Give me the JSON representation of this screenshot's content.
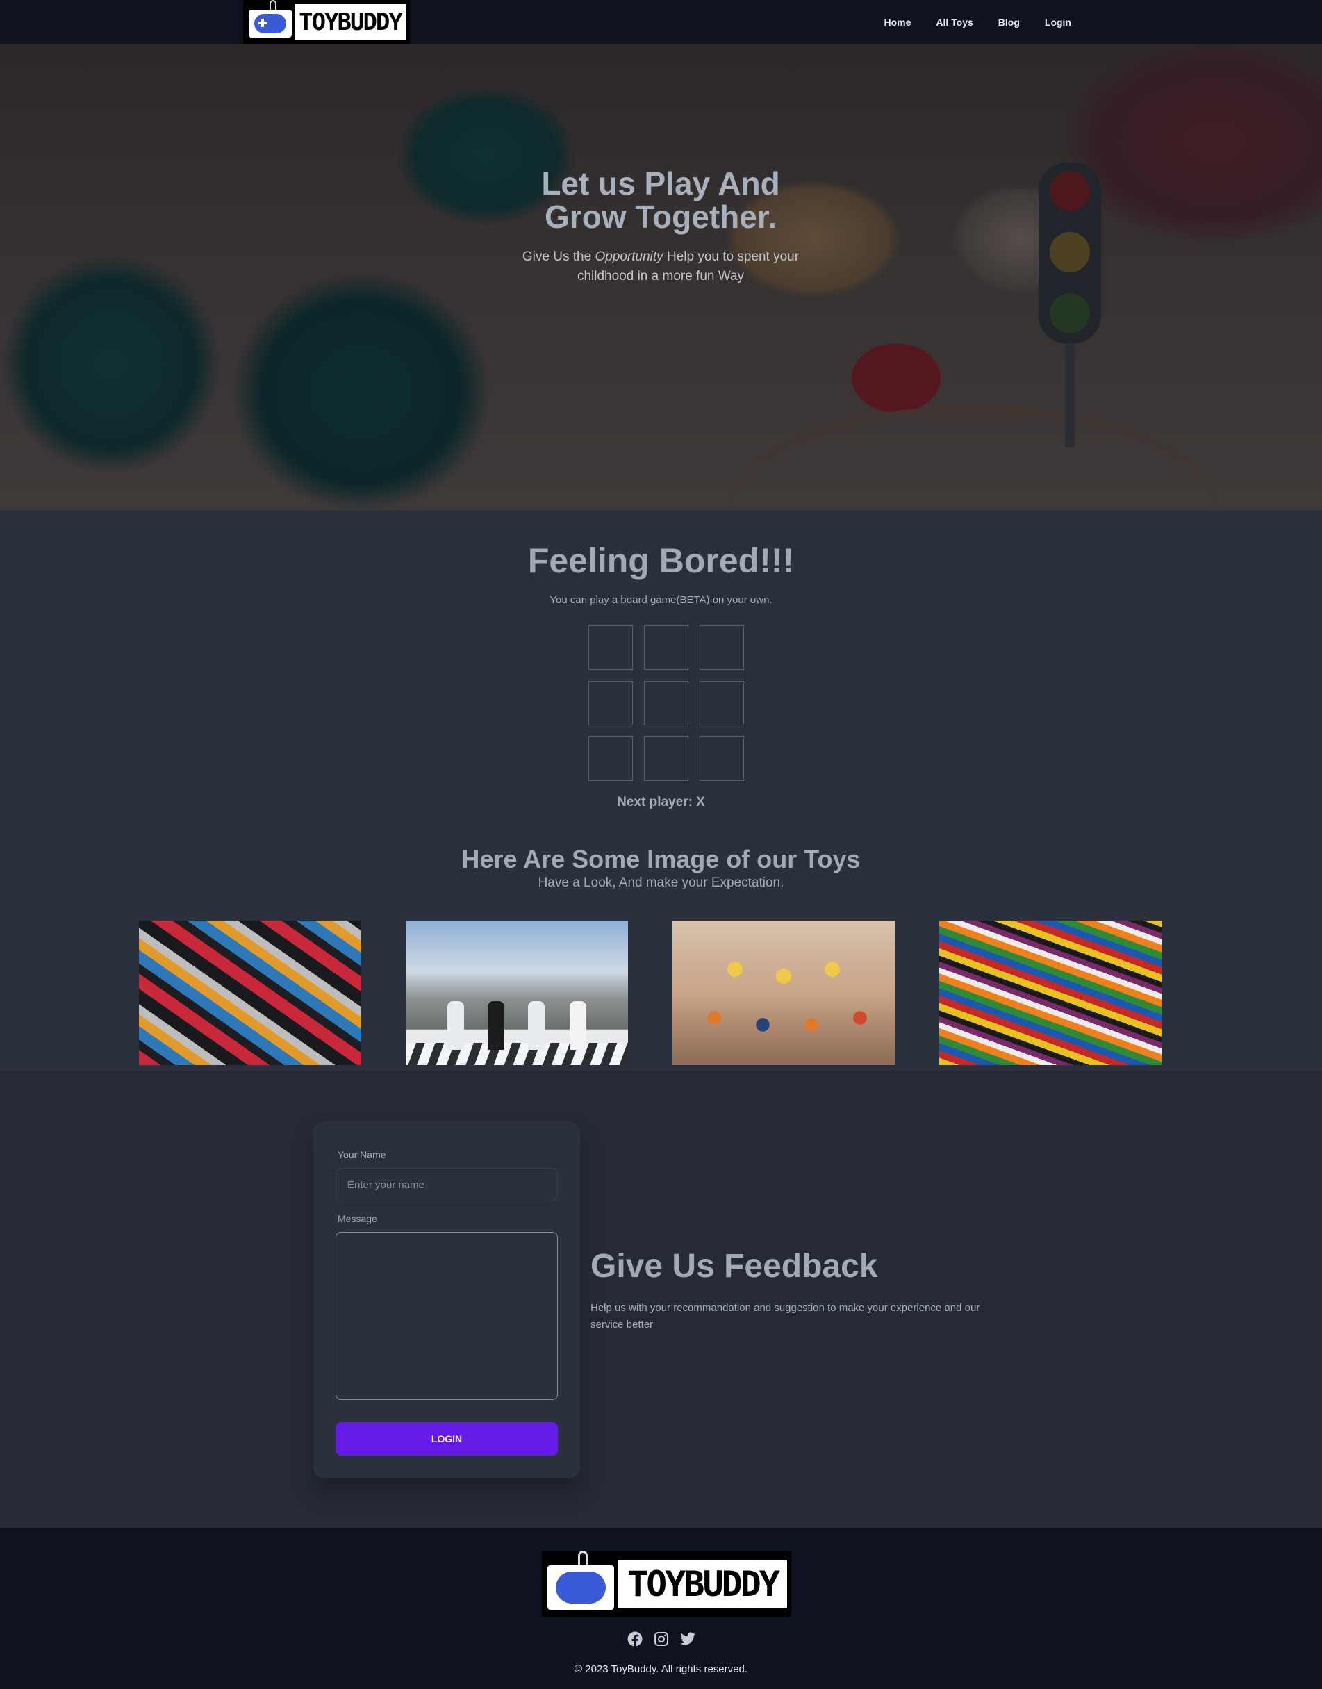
{
  "brand": {
    "name": "ToyBuddy",
    "logo_text": "TOYBUDDY"
  },
  "nav": {
    "links": [
      "Home",
      "All Toys",
      "Blog",
      "Login"
    ]
  },
  "hero": {
    "title": "Let us Play And Grow Together.",
    "subtitle_before": "Give Us the ",
    "subtitle_emphasis": "Opportunity",
    "subtitle_after": " Help you to spent your childhood in a more fun Way"
  },
  "game": {
    "title": "Feeling Bored!!!",
    "subtitle": "You can play a board game(BETA) on your own.",
    "cells": [
      "",
      "",
      "",
      "",
      "",
      "",
      "",
      "",
      ""
    ],
    "status": "Next player: X"
  },
  "gallery": {
    "title": "Here Are Some Image of our Toys",
    "subtitle": "Have a Look, And make your Expectation.",
    "images": [
      "lego-bricks-pile",
      "lego-figures-crosswalk",
      "lego-minifigures-crowd",
      "colorful-lego-pile"
    ]
  },
  "feedback": {
    "name_label": "Your Name",
    "name_placeholder": "Enter your name",
    "name_value": "",
    "message_label": "Message",
    "message_value": "",
    "submit_label": "Login",
    "title": "Give Us Feedback",
    "text": "Help us with your recommandation and suggestion to make your experience and our service better"
  },
  "footer": {
    "social_icons": [
      "facebook-icon",
      "instagram-icon",
      "twitter-icon"
    ],
    "copyright": "© 2023 ToyBuddy. All rights reserved."
  },
  "colors": {
    "navbar": "#0f1320",
    "page": "#2a303c",
    "primary": "#661ae6",
    "heading": "#a2a9b7"
  }
}
